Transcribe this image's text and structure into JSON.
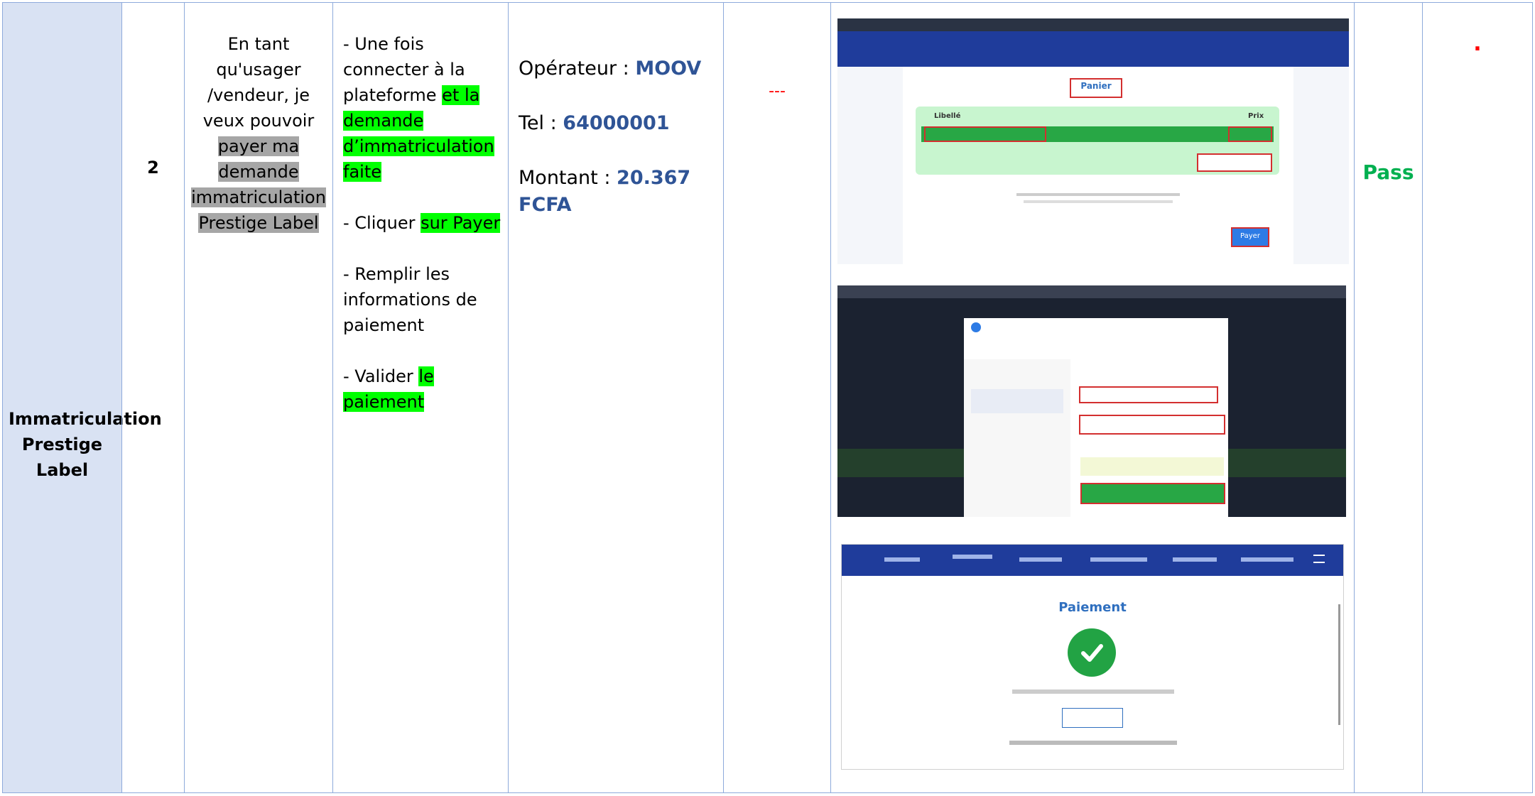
{
  "feature": "Immatriculation Prestige Label",
  "step_number": "2",
  "story": {
    "part1": "En tant qu'usager /vendeur, je veux pouvoir ",
    "part2": "payer ma demande immatriculation Prestige Label"
  },
  "steps": [
    {
      "plain": "- Une fois connecter à la plateforme ",
      "highlight": "et la demande d’immatriculation faite"
    },
    {
      "plain": "- Cliquer ",
      "highlight": "sur Payer"
    },
    {
      "plain": "-  Remplir les informations de paiement",
      "highlight": ""
    },
    {
      "plain": "- Valider ",
      "highlight": "le paiement"
    }
  ],
  "test_data": {
    "operator_label": "Opérateur : ",
    "operator_value": "MOOV",
    "tel_label": "Tel : ",
    "tel_value": "64000001",
    "amount_label": "Montant : ",
    "amount_value": "20.367 FCFA"
  },
  "expected_result": "---",
  "status": "Pass",
  "comment": ".",
  "screens": {
    "cart_title": "Panier",
    "cart_label": "Libellé",
    "cart_price": "Prix",
    "cart_pay": "Payer",
    "payment_title": "Paiement",
    "colors": {
      "cart_panel": "#c8f5cf",
      "nav": "#1f3c9b",
      "success": "#22a344"
    }
  },
  "colors": {
    "label_bg": "#d9e2f3",
    "border": "#8eaadb",
    "highlight_green": "#00ff00",
    "highlight_gray": "#a6a6a6",
    "value_blue": "#2f5496",
    "pass_green": "#00b050",
    "red": "#ff0000"
  }
}
